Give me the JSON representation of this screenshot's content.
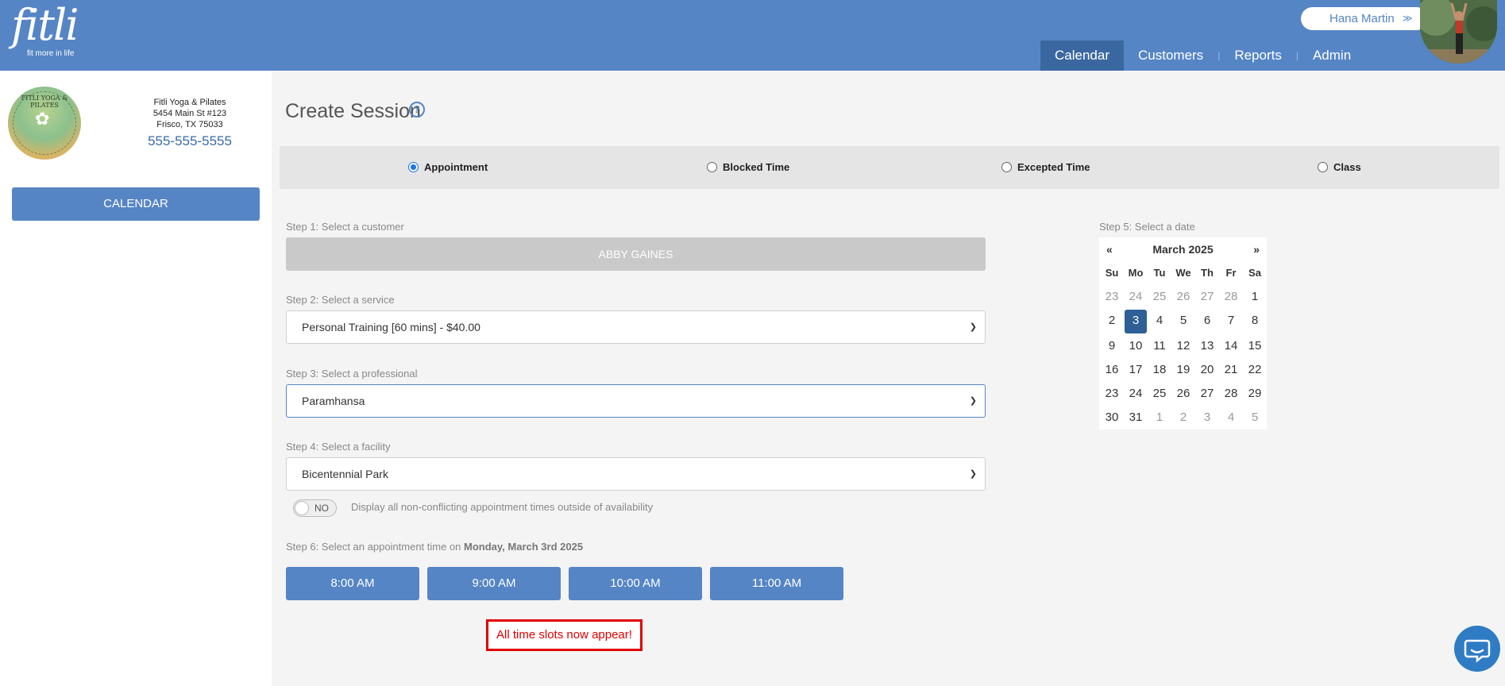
{
  "brand": {
    "name": "fitli",
    "tagline": "fit more in life"
  },
  "user": {
    "name": "Hana Martin"
  },
  "nav": [
    {
      "label": "Calendar",
      "active": true
    },
    {
      "label": "Customers",
      "active": false
    },
    {
      "label": "Reports",
      "active": false
    },
    {
      "label": "Admin",
      "active": false
    }
  ],
  "sidebar": {
    "business_name": "Fitli Yoga & Pilates",
    "address_line1": "5454 Main St #123",
    "address_line2": "Frisco, TX 75033",
    "phone": "555-555-5555",
    "logo_text": "FITLI YOGA & PILATES",
    "calendar_button": "CALENDAR"
  },
  "page": {
    "title": "Create Session",
    "help_icon": "?"
  },
  "session_types": [
    {
      "label": "Appointment",
      "selected": true
    },
    {
      "label": "Blocked Time",
      "selected": false
    },
    {
      "label": "Excepted Time",
      "selected": false
    },
    {
      "label": "Class",
      "selected": false
    }
  ],
  "steps": {
    "customer": {
      "label": "Step 1: Select a customer",
      "value": "ABBY GAINES"
    },
    "service": {
      "label": "Step 2: Select a service",
      "value": "Personal Training [60 mins] - $40.00"
    },
    "professional": {
      "label": "Step 3: Select a professional",
      "value": "Paramhansa"
    },
    "facility": {
      "label": "Step 4: Select a facility",
      "value": "Bicentennial Park"
    },
    "date": {
      "label": "Step 5: Select a date"
    },
    "time": {
      "label_prefix": "Step 6: Select an appointment time on ",
      "label_date": "Monday, March 3rd 2025"
    }
  },
  "availability_toggle": {
    "state": "NO",
    "text": "Display all non-conflicting appointment times outside of availability"
  },
  "time_slots": [
    "8:00 AM",
    "9:00 AM",
    "10:00 AM",
    "11:00 AM"
  ],
  "notice": "All time slots now appear!",
  "calendar": {
    "prev": "«",
    "next": "»",
    "month_label": "March 2025",
    "weekdays": [
      "Su",
      "Mo",
      "Tu",
      "We",
      "Th",
      "Fr",
      "Sa"
    ],
    "weeks": [
      [
        "23",
        "24",
        "25",
        "26",
        "27",
        "28",
        "1"
      ],
      [
        "2",
        "3",
        "4",
        "5",
        "6",
        "7",
        "8"
      ],
      [
        "9",
        "10",
        "11",
        "12",
        "13",
        "14",
        "15"
      ],
      [
        "16",
        "17",
        "18",
        "19",
        "20",
        "21",
        "22"
      ],
      [
        "23",
        "24",
        "25",
        "26",
        "27",
        "28",
        "29"
      ],
      [
        "30",
        "31",
        "1",
        "2",
        "3",
        "4",
        "5"
      ]
    ],
    "selected_day": "3"
  },
  "colors": {
    "header": "#5585c5",
    "nav_active": "#3a679f",
    "selected_day": "#2e5f97",
    "notice": "#e00000"
  },
  "icons": {
    "help": "question-circle-icon",
    "chat": "chat-bubble-icon",
    "chevron": "chevron-down-icon"
  }
}
